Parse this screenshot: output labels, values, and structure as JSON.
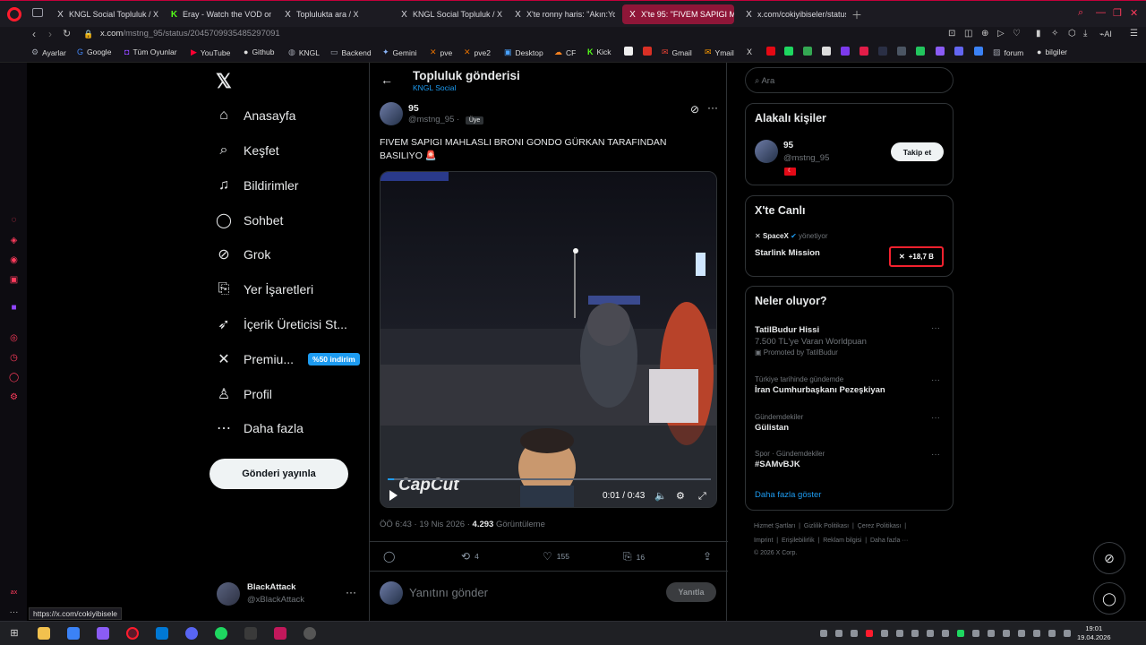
{
  "browser": {
    "tabs": [
      {
        "label": "KNGL Social Topluluk / X",
        "icon": "X"
      },
      {
        "label": "Eray - Watch the VOD on K",
        "icon": "K"
      },
      {
        "label": "Toplulukta ara / X",
        "icon": "X"
      },
      {
        "label": "KNGL Social Topluluk / X",
        "icon": "X"
      },
      {
        "label": "X'te ronny haris: \"Akın:Yo",
        "icon": "X"
      },
      {
        "label": "X'te 95: \"FIVEM SAPIGI M",
        "icon": "X"
      },
      {
        "label": "x.com/cokiyibiseler/status",
        "icon": "X"
      }
    ],
    "url_host": "x.com",
    "url_path": "/mstng_95/status/2045709935485297091",
    "bookmarks": [
      "Ayarlar",
      "Google",
      "Tüm Oyunlar",
      "YouTube",
      "Github",
      "KNGL",
      "Backend",
      "Gemini",
      "pve",
      "pve2",
      "Desktop",
      "CF",
      "Kick",
      "Gmail",
      "Ymail",
      "forum",
      "bilgiler"
    ],
    "status_url": "https://x.com/cokiyibisele",
    "toolbar_ai": "AI"
  },
  "nav": {
    "items": [
      {
        "label": "Anasayfa",
        "icon": "home-icon"
      },
      {
        "label": "Keşfet",
        "icon": "search-icon"
      },
      {
        "label": "Bildirimler",
        "icon": "bell-icon"
      },
      {
        "label": "Sohbet",
        "icon": "chat-icon"
      },
      {
        "label": "Grok",
        "icon": "grok-icon"
      },
      {
        "label": "Yer İşaretleri",
        "icon": "bookmark-icon"
      },
      {
        "label": "İçerik Üreticisi St...",
        "icon": "rocket-icon"
      },
      {
        "label": "Premiu...",
        "icon": "x-icon"
      },
      {
        "label": "Profil",
        "icon": "person-icon"
      },
      {
        "label": "Daha fazla",
        "icon": "more-icon"
      }
    ],
    "premium_badge": "%50 indirim",
    "post_button": "Gönderi yayınla",
    "account": {
      "name": "BlackAttack",
      "handle": "@xBlackAttack"
    }
  },
  "post": {
    "header_title": "Topluluk gönderisi",
    "header_sub": "KNGL Social",
    "author_name": "95",
    "author_handle": "@mstng_95",
    "member_badge": "Üye",
    "text": "FIVEM SAPIGI MAHLASLI BRONI GONDO GÜRKAN TARAFINDAN BASILIYO 🚨",
    "video": {
      "watermark": "CapCut",
      "time": "0:01 / 0:43",
      "progress": 0.02
    },
    "time": "ÖÖ 6:43",
    "date": "19 Nis 2026",
    "views": "4.293",
    "views_label": "Görüntüleme",
    "counts": {
      "reposts": "4",
      "likes": "155",
      "bookmarks": "16"
    },
    "reply_placeholder": "Yanıtını gönder",
    "reply_button": "Yanıtla"
  },
  "sidebar": {
    "search_placeholder": "Ara",
    "related": {
      "title": "Alakalı kişiler",
      "name": "95",
      "handle": "@mstng_95",
      "follow": "Takip et"
    },
    "live": {
      "title": "X'te Canlı",
      "host": "SpaceX",
      "host_suffix": "yönetiyor",
      "name": "Starlink Mission",
      "count": "+18,7 B"
    },
    "trends_title": "Neler oluyor?",
    "trends": [
      {
        "context": "",
        "name": "TatilBudur Hissi",
        "desc": "7.500 TL'ye Varan Worldpuan",
        "promoted": "Promoted by TatilBudur"
      },
      {
        "context": "Türkiye tarihinde gündemde",
        "name": "İran Cumhurbaşkanı Pezeşkiyan",
        "desc": "",
        "promoted": ""
      },
      {
        "context": "Gündemdekiler",
        "name": "Gülistan",
        "desc": "",
        "promoted": ""
      },
      {
        "context": "Spor · Gündemdekiler",
        "name": "#SAMvBJK",
        "desc": "",
        "promoted": ""
      }
    ],
    "show_more": "Daha fazla göster",
    "footer_line1": [
      "Hizmet Şartları",
      "Gizlilik Politikası",
      "Çerez Politikası"
    ],
    "footer_line2": [
      "Imprint",
      "Erişilebilirlik",
      "Reklam bilgisi",
      "Daha fazla ···"
    ],
    "copyright": "© 2026 X Corp."
  },
  "taskbar": {
    "time": "19:01",
    "date": "19.04.2026"
  },
  "colors": {
    "accent": "#1d9bf0",
    "tab_active": "#8f1638",
    "opera": "#ff1b2d"
  }
}
